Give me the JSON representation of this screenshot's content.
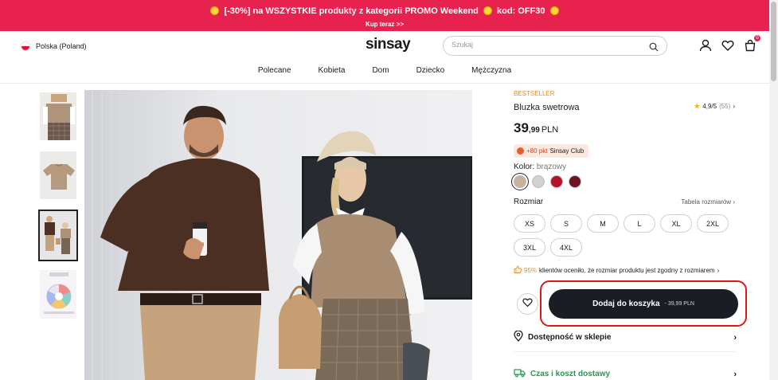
{
  "promo": {
    "text": "[-30%] na WSZYSTKIE produkty z kategorii PROMO Weekend",
    "code_text": "kod: OFF30",
    "cta": "Kup teraz >>"
  },
  "header": {
    "country": "Polska (Poland)",
    "logo": "sinsay",
    "search_placeholder": "Szukaj",
    "cart_count": "0"
  },
  "nav": {
    "items": [
      "Polecane",
      "Kobieta",
      "Dom",
      "Dziecko",
      "Mężczyzna"
    ]
  },
  "product": {
    "badge": "BESTSELLER",
    "name": "Bluzka swetrowa",
    "rating": "4,9/5",
    "rating_count": "(55)",
    "price_main": "39",
    "price_cents": ",99",
    "currency": "PLN",
    "club_points": "+80 pkt",
    "club_name": "Sinsay Club",
    "color_label": "Kolor:",
    "color_value": "brązowy",
    "swatches": [
      "#c9b29c",
      "#d2d2d0",
      "#b5142b",
      "#6e1222"
    ],
    "size_label": "Rozmiar",
    "size_guide": "Tabela rozmiarów",
    "sizes": [
      "XS",
      "S",
      "M",
      "L",
      "XL",
      "2XL",
      "3XL",
      "4XL"
    ],
    "fit_pct": "95%",
    "fit_text": "klientów oceniło, że rozmiar produktu jest zgodny z rozmiarem",
    "add_to_cart": "Dodaj do koszyka",
    "add_to_cart_price": "- 39,99 PLN",
    "availability": "Dostępność w sklepie",
    "delivery": "Czas i koszt dostawy"
  },
  "colors": {
    "promo_bg": "#e8224f",
    "accent_orange": "#f08a1c",
    "cta_dark": "#1a1d24",
    "highlight_red": "#d61a1a",
    "delivery_green": "#1e9c4a"
  }
}
